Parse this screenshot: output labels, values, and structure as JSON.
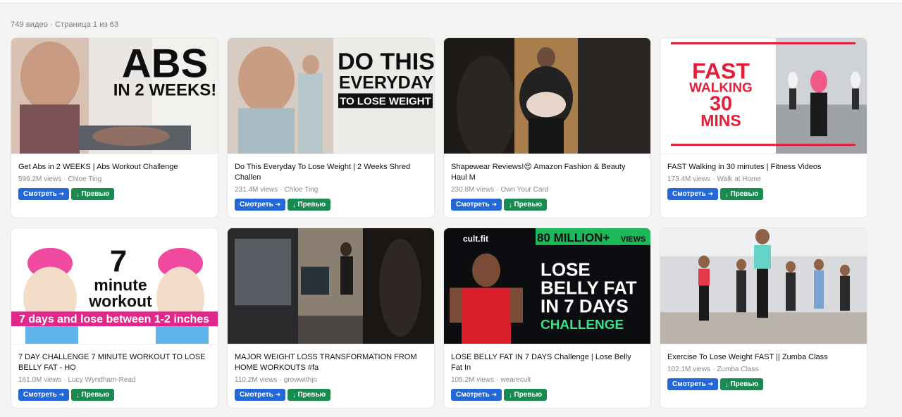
{
  "summary": {
    "count_text": "749 видео",
    "page_text": "Страница 1 из 63"
  },
  "labels": {
    "watch": "Смотреть",
    "preview": "Превью"
  },
  "icons": {
    "watch": "arrow-right-icon",
    "preview": "arrow-down-icon"
  },
  "colors": {
    "watch_button": "#2468d8",
    "preview_button": "#198a50",
    "thumb_magenta": "#e0288a"
  },
  "videos": [
    {
      "title": "Get Abs in 2 WEEKS | Abs Workout Challenge",
      "views": "599.2M views",
      "channel": "Chloe Ting",
      "overlay": [
        "ABS",
        "IN 2 WEEKS!"
      ]
    },
    {
      "title": "Do This Everyday To Lose Weight | 2 Weeks Shred Challen",
      "views": "231.4M views",
      "channel": "Chloe Ting",
      "overlay": [
        "DO THIS",
        "EVERYDAY",
        "TO LOSE WEIGHT"
      ]
    },
    {
      "title": "Shapewear Reviews!😍 Amazon Fashion & Beauty Haul M",
      "views": "230.8M views",
      "channel": "Own Your Card",
      "overlay": []
    },
    {
      "title": "FAST Walking in 30 minutes | Fitness Videos",
      "views": "173.4M views",
      "channel": "Walk at Home",
      "overlay": [
        "FAST",
        "WALKING",
        "30",
        "MINS"
      ]
    },
    {
      "title": "7 DAY CHALLENGE 7 MINUTE WORKOUT TO LOSE BELLY FAT - HO",
      "views": "161.0M views",
      "channel": "Lucy Wyndham-Read",
      "overlay": [
        "7",
        "minute",
        "workout",
        "7 days and lose between 1-2 inches"
      ]
    },
    {
      "title": "MAJOR WEIGHT LOSS TRANSFORMATION FROM HOME WORKOUTS #fa",
      "views": "110.2M views",
      "channel": "growwithjo",
      "overlay": []
    },
    {
      "title": "LOSE BELLY FAT IN 7 DAYS Challenge | Lose Belly Fat In",
      "views": "105.2M views",
      "channel": "wearecult",
      "overlay": [
        "cult.fit",
        "80 MILLION+",
        "VIEWS",
        "LOSE",
        "BELLY FAT",
        "IN 7 DAYS",
        "CHALLENGE"
      ]
    },
    {
      "title": "Exercise To Lose Weight FAST || Zumba Class",
      "views": "102.1M views",
      "channel": "Zumba Class",
      "overlay": []
    }
  ]
}
